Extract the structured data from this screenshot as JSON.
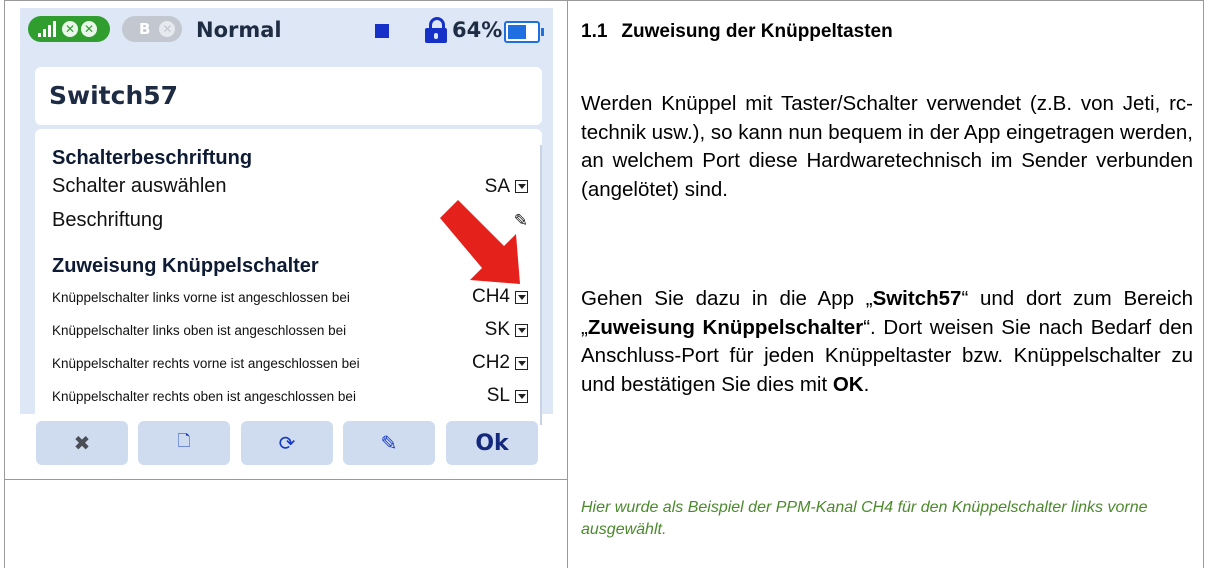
{
  "status_bar": {
    "mode": "Normal",
    "battery_percent": "64%",
    "battery_level": 0.64,
    "receiver_b": "B",
    "icons": [
      "signal-bars-icon",
      "close-circle-icon",
      "close-circle-icon",
      "stop-square-icon",
      "lock-icon",
      "battery-icon"
    ]
  },
  "app": {
    "title": "Switch57",
    "sections": [
      {
        "heading": "Schalterbeschriftung",
        "rows": [
          {
            "label": "Schalter auswählen",
            "value": "SA"
          },
          {
            "label": "Beschriftung",
            "value": ""
          }
        ]
      },
      {
        "heading": "Zuweisung Knüppelschalter",
        "rows": [
          {
            "label": "Knüppelschalter links vorne ist angeschlossen bei",
            "value": "CH4"
          },
          {
            "label": "Knüppelschalter links oben ist angeschlossen bei",
            "value": "SK"
          },
          {
            "label": "Knüppelschalter rechts vorne ist angeschlossen bei",
            "value": "CH2"
          },
          {
            "label": "Knüppelschalter rechts oben ist angeschlossen bei",
            "value": "SL"
          }
        ]
      }
    ],
    "toolbar": {
      "buttons": [
        "tools-icon",
        "document-icon",
        "refresh-icon",
        "edit-icon"
      ],
      "ok_label": "Ok"
    }
  },
  "doc": {
    "heading_number": "1.1",
    "heading_text": "Zuweisung der Knüppeltasten",
    "para1": "Werden Knüppel mit Taster/Schalter verwendet (z.B. von Jeti, rc-technik usw.), so kann nun bequem in der App eingetragen werden, an welchem Port diese Hardwaretechnisch im Sender verbunden (angelötet) sind.",
    "para2": {
      "t1": "Gehen Sie dazu in die App „",
      "b1": "Switch57",
      "t2": "“ und dort zum Bereich „",
      "b2": "Zuweisung Knüppelschalter",
      "t3": "“. Dort weisen Sie nach Bedarf den Anschluss-Port für jeden Knüppeltaster bzw. Knüppelschalter zu und bestätigen Sie dies mit ",
      "b3": "OK",
      "t4": "."
    },
    "note": "Hier wurde als Beispiel der PPM-Kanal CH4 für den Knüppelschalter links vorne ausgewählt."
  },
  "colors": {
    "screen_bg": "#dde7f6",
    "accent_blue": "#1631c8",
    "green_pill": "#2f9e2f",
    "arrow_red": "#e5211c",
    "note_green": "#4b8a2c"
  }
}
